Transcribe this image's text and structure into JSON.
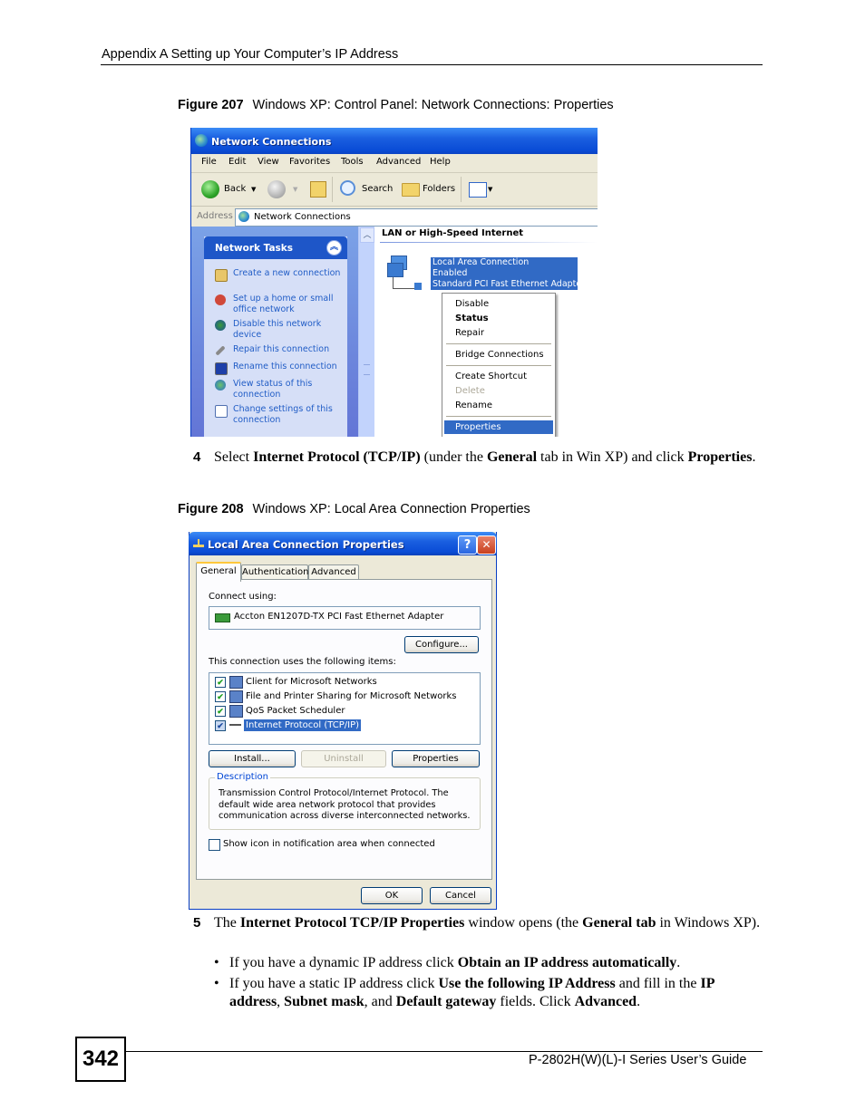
{
  "page": {
    "header": "Appendix A Setting up Your Computer’s IP Address",
    "page_number": "342",
    "footer": "P-2802H(W)(L)-I Series User’s Guide"
  },
  "figure207": {
    "label": "Figure 207",
    "caption": "Windows XP: Control Panel: Network Connections: Properties",
    "window": {
      "title": "Network Connections",
      "menu": [
        "File",
        "Edit",
        "View",
        "Favorites",
        "Tools",
        "Advanced",
        "Help"
      ],
      "toolbar": {
        "back": "Back",
        "search": "Search",
        "folders": "Folders"
      },
      "address_label": "Address",
      "address_value": "Network Connections",
      "tasks_title": "Network Tasks",
      "tasks": [
        {
          "label": "Create a new connection",
          "icon": "new-connection-icon"
        },
        {
          "label": "Set up a home or small office network",
          "icon": "home-network-icon"
        },
        {
          "label": "Disable this network device",
          "icon": "disable-device-icon"
        },
        {
          "label": "Repair this connection",
          "icon": "repair-icon"
        },
        {
          "label": "Rename this connection",
          "icon": "rename-icon"
        },
        {
          "label": "View status of this connection",
          "icon": "view-status-icon"
        },
        {
          "label": "Change settings of this connection",
          "icon": "change-settings-icon"
        }
      ],
      "group_header": "LAN or High-Speed Internet",
      "connection": {
        "name": "Local Area Connection",
        "status": "Enabled",
        "adapter": "Standard PCI Fast Ethernet Adapter"
      },
      "context_menu": [
        {
          "label": "Disable",
          "bold": false,
          "disabled": false
        },
        {
          "label": "Status",
          "bold": true,
          "disabled": false
        },
        {
          "label": "Repair",
          "bold": false,
          "disabled": false
        },
        {
          "label": "Bridge Connections",
          "bold": false,
          "disabled": false
        },
        {
          "label": "Create Shortcut",
          "bold": false,
          "disabled": false
        },
        {
          "label": "Delete",
          "bold": false,
          "disabled": true
        },
        {
          "label": "Rename",
          "bold": false,
          "disabled": false
        },
        {
          "label": "Properties",
          "bold": false,
          "disabled": false,
          "highlighted": true
        }
      ]
    }
  },
  "step4": {
    "num": "4",
    "t1": "Select ",
    "b1": "Internet Protocol (TCP/IP)",
    "t2": " (under the ",
    "b2": "General",
    "t3": " tab in Win XP) and click ",
    "b3": "Properties",
    "t4": "."
  },
  "figure208": {
    "label": "Figure 208",
    "caption": "Windows XP: Local Area Connection Properties",
    "dialog": {
      "title": "Local Area Connection Properties",
      "help_glyph": "?",
      "close_glyph": "✕",
      "tabs": [
        "General",
        "Authentication",
        "Advanced"
      ],
      "active_tab": "General",
      "connect_using_label": "Connect using:",
      "adapter": "Accton EN1207D-TX PCI Fast Ethernet Adapter",
      "configure_button": "Configure...",
      "items_label": "This connection uses the following items:",
      "items": [
        {
          "label": "Client for Microsoft Networks",
          "checked": true,
          "selected": false
        },
        {
          "label": "File and Printer Sharing for Microsoft Networks",
          "checked": true,
          "selected": false
        },
        {
          "label": "QoS Packet Scheduler",
          "checked": true,
          "selected": false
        },
        {
          "label": "Internet Protocol (TCP/IP)",
          "checked": true,
          "selected": true
        }
      ],
      "check_glyph": "✔",
      "install_button": "Install...",
      "uninstall_button": "Uninstall",
      "properties_button": "Properties",
      "description_legend": "Description",
      "description_text": "Transmission Control Protocol/Internet Protocol. The default wide area network protocol that provides communication across diverse interconnected networks.",
      "show_icon_label": "Show icon in notification area when connected",
      "show_icon_checked": false,
      "ok_button": "OK",
      "cancel_button": "Cancel"
    }
  },
  "step5": {
    "num": "5",
    "t1": "The ",
    "b1": "Internet Protocol TCP/IP Properties",
    "t2": " window opens (the ",
    "b2": "General tab",
    "t3": " in Windows XP).",
    "bullets": [
      {
        "t1": "If you have a dynamic IP address click ",
        "b1": "Obtain an IP address automatically",
        "t2": "."
      },
      {
        "t1": "If you have a static IP address click ",
        "b1": "Use the following IP Address",
        "t2": " and fill in the ",
        "b2": "IP address",
        "t3": ", ",
        "b3": "Subnet mask",
        "t4": ", and ",
        "b4": "Default gateway",
        "t5": " fields. Click ",
        "b5": "Advanced",
        "t6": "."
      }
    ]
  }
}
